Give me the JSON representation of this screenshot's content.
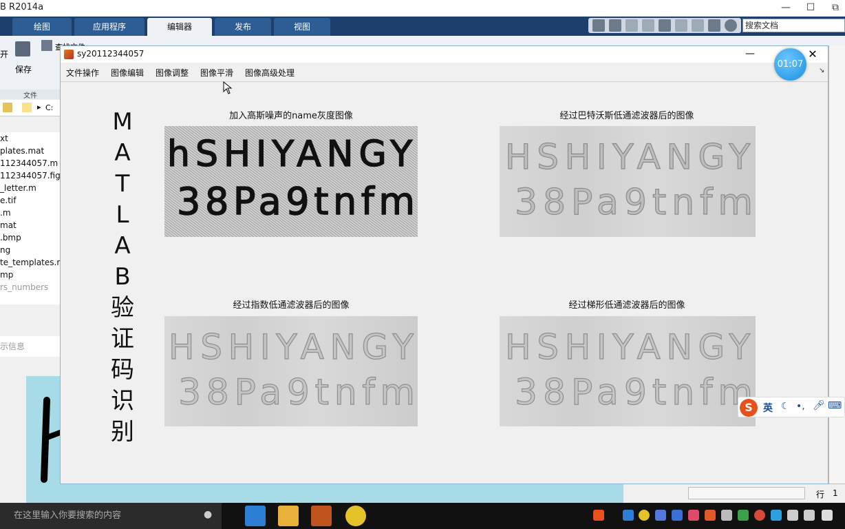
{
  "matlab_window": {
    "title": "B R2014a",
    "ribbon_tabs": [
      "绘图",
      "应用程序",
      "编辑器",
      "发布",
      "视图"
    ],
    "active_tab": "编辑器",
    "search_placeholder": "搜索文档",
    "ribbon_save_label": "保存",
    "ribbon_open_label": "开",
    "ribbon_section_label": "文件",
    "ribbon_doc_label": "查找文件"
  },
  "file_browser": {
    "address": "C:",
    "items": [
      "xt",
      "plates.mat",
      "112344057.m",
      "112344057.fig",
      "_letter.m",
      "e.tif",
      ".m",
      "mat",
      ".bmp",
      "ng",
      "te_templates.m",
      "mp",
      "rs_numbers"
    ],
    "details_label": "示信息"
  },
  "figure_window": {
    "title": "sy20112344057",
    "menu": [
      "文件操作",
      "图像编辑",
      "图像调整",
      "图像平滑",
      "图像高级处理"
    ],
    "timer": "01:07",
    "vertical_title": [
      "M",
      "A",
      "T",
      "L",
      "A",
      "B",
      "验",
      "证",
      "码",
      "识",
      "别"
    ],
    "axes": [
      {
        "title": "加入高斯噪声的name灰度图像",
        "line1": "hSHIYANGY",
        "line2": "38Pa9tnfm"
      },
      {
        "title": "经过巴特沃斯低通滤波器后的图像",
        "line1": "HSHIYANGY",
        "line2": "38Pa9tnfm"
      },
      {
        "title": "经过指数低通滤波器后的图像",
        "line1": "HSHIYANGY",
        "line2": "38Pa9tnfm"
      },
      {
        "title": "经过梯形低通滤波器后的图像",
        "line1": "HSHIYANGY",
        "line2": "38Pa9tnfm"
      }
    ]
  },
  "status_bar": {
    "row_label": "行",
    "row_value": "1"
  },
  "taskbar": {
    "search_placeholder": "在这里输入你要搜索的内容"
  },
  "ime": {
    "logo": "S",
    "lang": "英"
  },
  "colors": {
    "ribbon_dark": "#1c3f6b",
    "ribbon_tab": "#2e5d94",
    "figure_bg": "#f0f0f0",
    "bg_figure_cyan": "#a7dbe8"
  }
}
